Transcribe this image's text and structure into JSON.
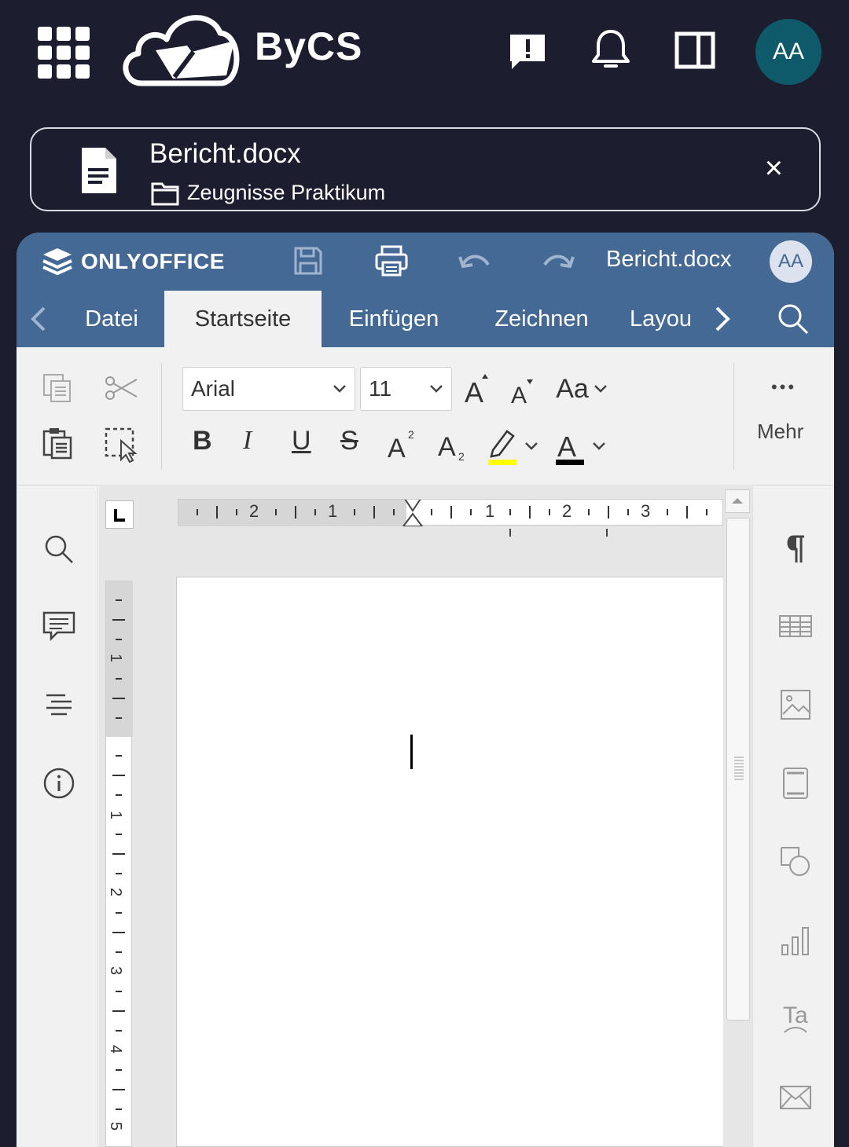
{
  "topbar": {
    "brand": "ByCS",
    "avatar_initials": "AA",
    "icons": [
      "apps-grid-icon",
      "feedback-icon",
      "bell-icon",
      "sidebar-panel-icon"
    ]
  },
  "file_card": {
    "file_name": "Bericht.docx",
    "folder_name": "Zeugnisse Praktikum",
    "close_label": "×"
  },
  "editor": {
    "brand": "ONLYOFFICE",
    "doc_title": "Bericht.docx",
    "avatar_initials": "AA",
    "tabs": [
      {
        "label": "Datei",
        "active": false
      },
      {
        "label": "Startseite",
        "active": true
      },
      {
        "label": "Einfügen",
        "active": false
      },
      {
        "label": "Zeichnen",
        "active": false
      },
      {
        "label": "Layou",
        "active": false
      }
    ],
    "toolbar": {
      "font_name": "Arial",
      "font_size": "11",
      "change_case": "Aa",
      "bold": "B",
      "italic": "I",
      "underline": "U",
      "strikethrough": "S",
      "more_label": "Mehr",
      "more_dots": "•••",
      "highlight_color": "#ffff00",
      "font_color": "#000000"
    },
    "ruler": {
      "h_ticks_left": [
        "2",
        "1"
      ],
      "h_ticks_right": [
        "1",
        "2",
        "3"
      ],
      "v_ticks": [
        "1",
        "1",
        "2",
        "3",
        "4",
        "5"
      ]
    }
  },
  "colors": {
    "app_bg": "#1c1e30",
    "editor_header": "#446995",
    "avatar_top": "#0e5a6a"
  }
}
